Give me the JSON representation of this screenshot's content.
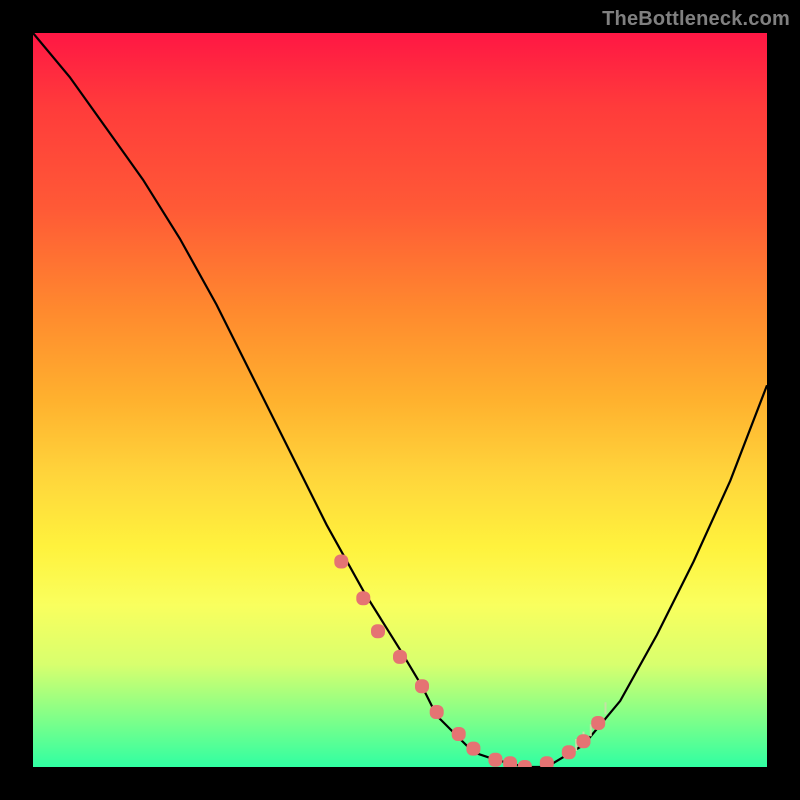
{
  "watermark": "TheBottleneck.com",
  "colors": {
    "page_bg": "#000000",
    "gradient_top": "#ff1744",
    "gradient_mid": "#ffd43b",
    "gradient_bottom": "#30ffa2",
    "curve": "#000000",
    "dots": "#e57373",
    "tick": "#c5e1a5"
  },
  "chart_data": {
    "type": "line",
    "title": "",
    "xlabel": "",
    "ylabel": "",
    "ylim": [
      0,
      100
    ],
    "xlim": [
      0,
      100
    ],
    "x": [
      0,
      5,
      10,
      15,
      20,
      25,
      30,
      35,
      40,
      45,
      50,
      53,
      55,
      58,
      60,
      63,
      67,
      70,
      75,
      80,
      85,
      90,
      95,
      100
    ],
    "values": [
      100,
      94,
      87,
      80,
      72,
      63,
      53,
      43,
      33,
      24,
      16,
      11,
      7,
      4,
      2,
      1,
      0,
      0,
      3,
      9,
      18,
      28,
      39,
      52
    ],
    "dots": {
      "x": [
        42,
        45,
        47,
        50,
        53,
        55,
        58,
        60,
        63,
        65,
        67,
        70,
        73,
        75,
        77
      ],
      "y": [
        28,
        23,
        18.5,
        15,
        11,
        7.5,
        4.5,
        2.5,
        1,
        0.5,
        0,
        0.5,
        2,
        3.5,
        6
      ]
    },
    "ticks": {
      "x": [
        73,
        74,
        75,
        76,
        77,
        78
      ],
      "y": [
        2,
        3,
        4,
        5,
        6,
        8
      ]
    }
  }
}
